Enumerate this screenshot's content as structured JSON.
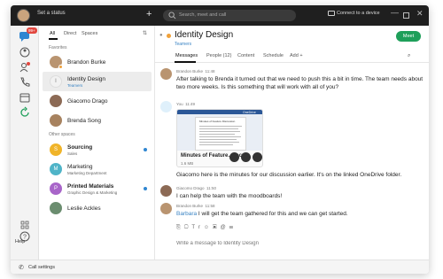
{
  "titlebar": {
    "status": "Set a status",
    "new_label": "+",
    "search_placeholder": "Search, meet and call",
    "device_label": "Connect to a device",
    "minimize": "—",
    "close": "✕"
  },
  "rail": {
    "badge": "99+",
    "help": "Help"
  },
  "list": {
    "tabs": [
      "All",
      "Direct",
      "Spaces"
    ],
    "favorites_header": "Favorites",
    "other_header": "Other spaces",
    "favorites": [
      {
        "name": "Brandon Burke",
        "sub": ""
      },
      {
        "name": "Identity Design",
        "sub": "Teamers"
      },
      {
        "name": "Giacomo Drago",
        "sub": ""
      },
      {
        "name": "Brenda Song",
        "sub": ""
      }
    ],
    "others": [
      {
        "letter": "S",
        "name": "Sourcing",
        "sub": "Sales"
      },
      {
        "letter": "M",
        "name": "Marketing",
        "sub": "Marketing Department"
      },
      {
        "letter": "P",
        "name": "Printed Materials",
        "sub": "Graphic Design & Marketing"
      },
      {
        "letter": "",
        "name": "Leslie Ackles",
        "sub": ""
      }
    ]
  },
  "bottombar": {
    "call_settings": "Call settings"
  },
  "main": {
    "title": "Identity Design",
    "subtitle": "Teamers",
    "meet_label": "Meet",
    "tabs": [
      "Messages",
      "People (12)",
      "Content",
      "Schedule",
      "Add +"
    ],
    "messages": [
      {
        "author": "Brandon Burke",
        "time": "11:48",
        "text": "After talking to Brenda it turned out that we need to push this a bit in time. The team needs about two more weeks. Is this something that will work with all of you?"
      },
      {
        "author": "You",
        "time": "11:49",
        "text": "Giacomo here is the minutes for our discussion earlier. It's on the linked OneDrive folder."
      },
      {
        "author": "Giacomo Drago",
        "time": "11:50",
        "text": "I can help the team with the moodboards!"
      },
      {
        "author": "Brandon Burke",
        "time": "11:58",
        "mention": "Barbara",
        "text": " I will get the team gathered for this and we can get started."
      }
    ],
    "attachment": {
      "name": "Minutes of Feature...docx",
      "size": "1.6 MB",
      "doc_heading": "Minutes of Feature Discussion",
      "service": "OneDrive"
    },
    "composer_placeholder": "Write a message to Identity Design"
  },
  "colors": {
    "accent_green": "#1e9f5a",
    "link_blue": "#3a84c4",
    "unread_dot": "#2f86d1",
    "badge_red": "#e2473f",
    "status_orange": "#f0a13a"
  }
}
